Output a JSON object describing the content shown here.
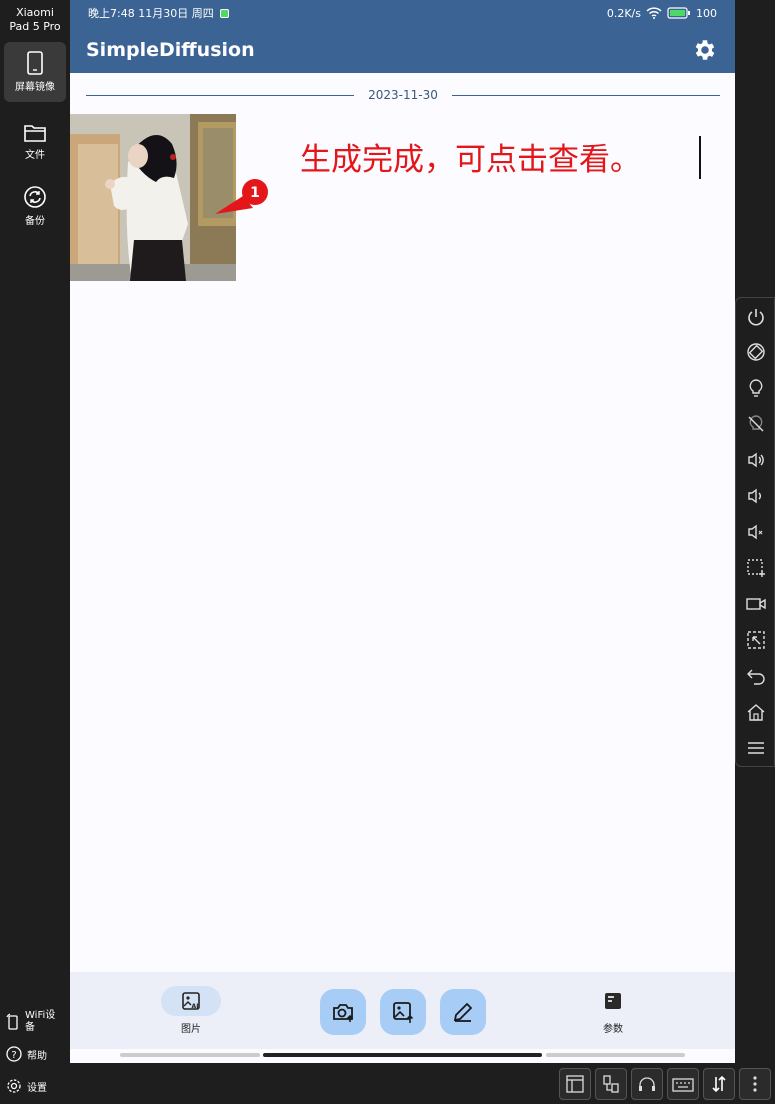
{
  "device": {
    "name_line1": "Xiaomi",
    "name_line2": "Pad 5 Pro"
  },
  "sidebar": {
    "items": [
      {
        "label": "屏幕镜像",
        "icon": "phone-icon"
      },
      {
        "label": "文件",
        "icon": "folder-icon"
      },
      {
        "label": "备份",
        "icon": "sync-icon"
      }
    ],
    "bottom": [
      {
        "label": "WiFi设备",
        "icon": "wifi-device-icon"
      },
      {
        "label": "帮助",
        "icon": "help-icon"
      },
      {
        "label": "设置",
        "icon": "gear-icon"
      }
    ]
  },
  "status_bar": {
    "time": "晚上7:48 11月30日 周四",
    "speed": "0.2K/s",
    "battery": "100"
  },
  "app": {
    "title": "SimpleDiffusion"
  },
  "history": {
    "date": "2023-11-30",
    "badge_count": "1"
  },
  "annotation": {
    "text": "生成完成，可点击查看。"
  },
  "bottom_nav": {
    "tab_images": "图片",
    "tab_params": "参数"
  },
  "right_toolbar": {
    "icons": [
      "power-icon",
      "rotate-icon",
      "light-on-icon",
      "light-off-icon",
      "volume-up-icon",
      "volume-down-icon",
      "volume-mute-icon",
      "screenshot-icon",
      "record-icon",
      "region-capture-icon",
      "back-icon",
      "home-icon",
      "menu-icon"
    ]
  },
  "colors": {
    "app_bar": "#3b6394",
    "annotation": "#e3161a",
    "fab": "#a7cdf7",
    "accent": "#2aa0ff"
  }
}
